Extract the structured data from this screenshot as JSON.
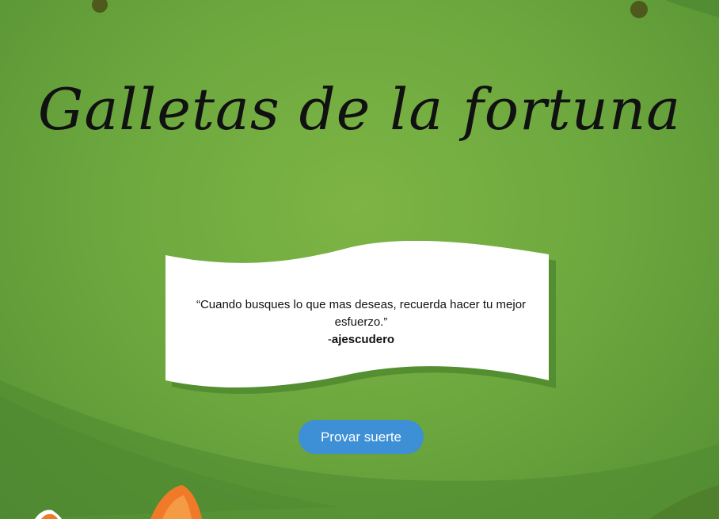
{
  "page": {
    "title": "Galletas de la fortuna"
  },
  "fortune": {
    "quote": "“Cuando busques lo que mas deseas, recuerda hacer tu mejor esfuerzo.”",
    "author_prefix": "-",
    "author": "ajescudero"
  },
  "actions": {
    "try_luck_label": "Provar suerte"
  },
  "colors": {
    "background": "#6ea93f",
    "button": "#3d8fd6",
    "paper": "#ffffff",
    "paper_shadow": "#4f8a2e"
  },
  "icons": {
    "decor": [
      "seed-dot-icon",
      "leaf-icon",
      "bird-icon"
    ]
  }
}
